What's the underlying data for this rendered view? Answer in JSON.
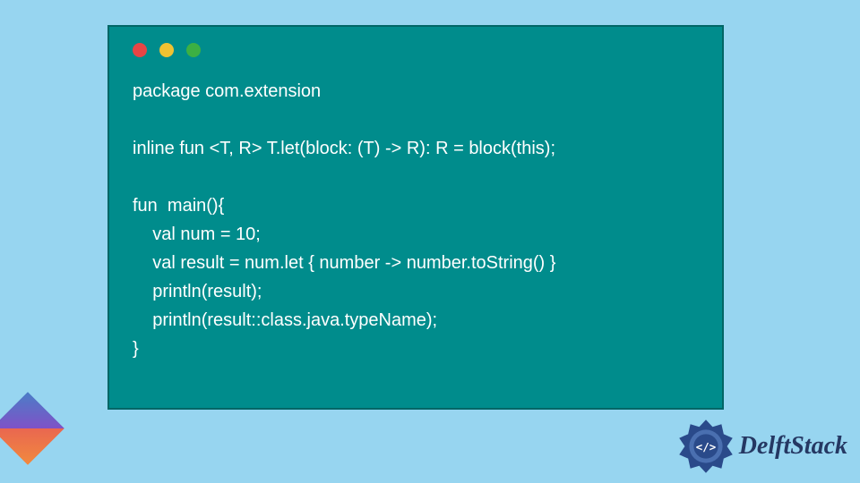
{
  "code": {
    "line1": "package com.extension",
    "line2": "",
    "line3": "inline fun <T, R> T.let(block: (T) -> R): R = block(this);",
    "line4": "",
    "line5": "fun  main(){",
    "line6": "    val num = 10;",
    "line7": "    val result = num.let { number -> number.toString() }",
    "line8": "    println(result);",
    "line9": "    println(result::class.java.typeName);",
    "line10": "}"
  },
  "brand": "DelftStack",
  "colors": {
    "bg": "#97d5f0",
    "panel": "#008c8c",
    "text": "#ffffff"
  }
}
